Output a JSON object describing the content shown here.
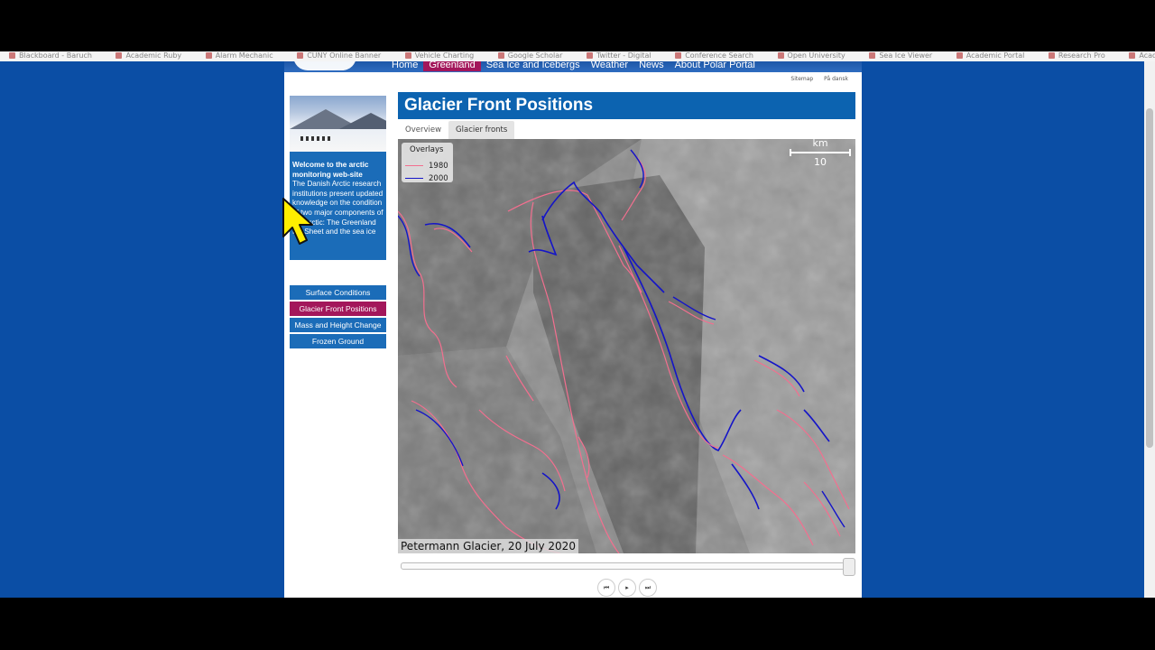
{
  "bookmarks": [
    "Blackboard - Baruch",
    "Academic Ruby",
    "Alarm Mechanic",
    "CUNY Online Banner",
    "Vehicle Charting",
    "Google Scholar",
    "Twitter - Digital",
    "Conference Search",
    "Open University",
    "Sea Ice Viewer",
    "Academic Portal",
    "Research Pro",
    "Academic Ruby"
  ],
  "nav": {
    "items": [
      "Home",
      "Greenland",
      "Sea Ice and Icebergs",
      "Weather",
      "News",
      "About Polar Portal"
    ],
    "active": "Greenland",
    "sitemap": "Sitemap",
    "language": "På dansk"
  },
  "sidebar": {
    "welcome_title": "Welcome to the arctic monitoring web-site",
    "welcome_text": "The Danish Arctic research institutions present updated knowledge on the condition of two major components of the Arctic: The Greenland Ice Sheet and the sea ice",
    "buttons": [
      "Surface Conditions",
      "Glacier Front Positions",
      "Mass and Height Change",
      "Frozen Ground"
    ],
    "active_button": "Glacier Front Positions"
  },
  "main": {
    "title": "Glacier Front Positions",
    "tabs": [
      "Overview",
      "Glacier fronts"
    ],
    "active_tab": "Glacier fronts"
  },
  "map": {
    "legend_title": "Overlays",
    "legend": [
      {
        "label": "1980",
        "color": "#f36f8f"
      },
      {
        "label": "2000",
        "color": "#1414c8"
      }
    ],
    "scale_unit": "km",
    "scale_value": "10",
    "caption": "Petermann Glacier, 20 July 2020"
  },
  "player": {
    "progress": 1.0,
    "controls": [
      "previous-icon",
      "play-icon",
      "next-icon"
    ],
    "control_glyphs": [
      "⏮",
      "▸",
      "⏭"
    ]
  },
  "colors": {
    "page_bg": "#0b4ea5",
    "accent": "#a3175b",
    "brand": "#1b6cb8"
  }
}
